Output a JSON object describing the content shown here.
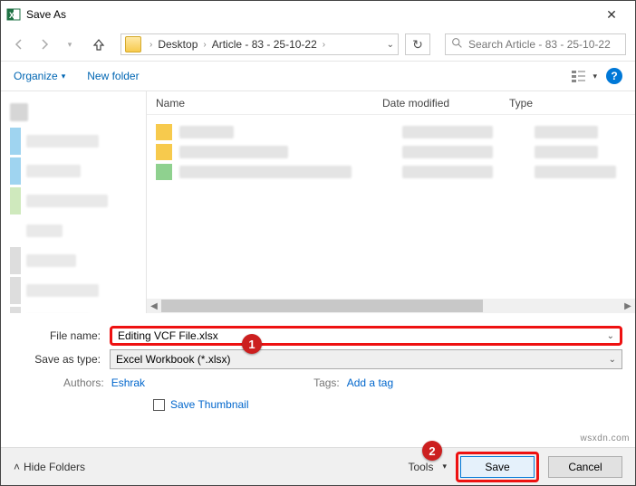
{
  "window": {
    "title": "Save As"
  },
  "address": {
    "crumb1": "Desktop",
    "crumb2": "Article - 83 - 25-10-22"
  },
  "search": {
    "placeholder": "Search Article - 83 - 25-10-22"
  },
  "toolbar": {
    "organize": "Organize",
    "new_folder": "New folder"
  },
  "columns": {
    "name": "Name",
    "date": "Date modified",
    "type": "Type"
  },
  "form": {
    "filename_label": "File name:",
    "filename_value": "Editing VCF File.xlsx",
    "savetype_label": "Save as type:",
    "savetype_value": "Excel Workbook (*.xlsx)"
  },
  "meta": {
    "authors_label": "Authors:",
    "authors_value": "Eshrak",
    "tags_label": "Tags:",
    "tags_value": "Add a tag"
  },
  "thumb": {
    "label": "Save Thumbnail"
  },
  "footer": {
    "hide_folders": "Hide Folders",
    "tools": "Tools",
    "save": "Save",
    "cancel": "Cancel"
  },
  "annotations": {
    "a1": "1",
    "a2": "2"
  },
  "watermark": "wsxdn.com"
}
